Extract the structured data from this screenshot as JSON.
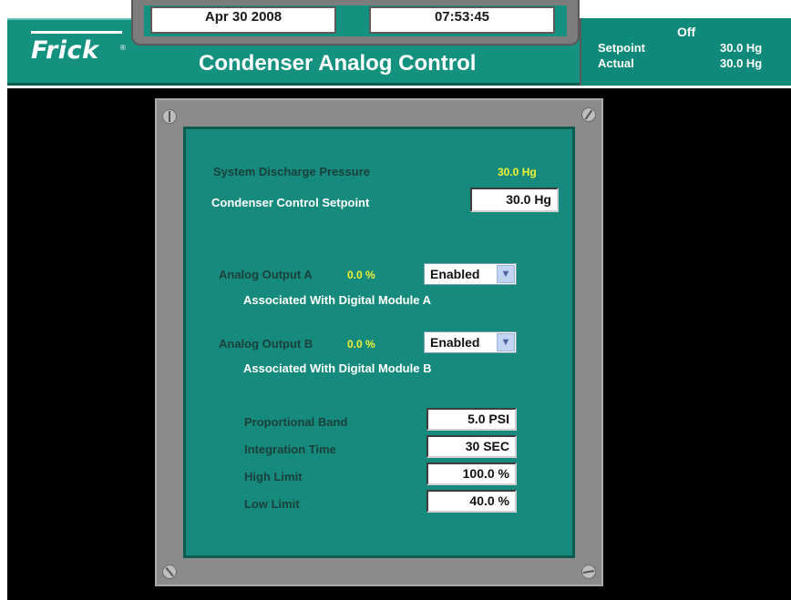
{
  "header": {
    "date": "Apr 30 2008",
    "time": "07:53:45",
    "logo": "Frick",
    "logo_mark": "®",
    "title": "Condenser Analog Control"
  },
  "status": {
    "state": "Off",
    "setpoint_label": "Setpoint",
    "setpoint_value": "30.0 Hg",
    "actual_label": "Actual",
    "actual_value": "30.0 Hg"
  },
  "panel": {
    "discharge_label": "System Discharge Pressure",
    "discharge_value": "30.0 Hg",
    "setpoint_label": "Condenser Control Setpoint",
    "setpoint_value": "30.0 Hg",
    "output_a": {
      "label": "Analog Output A",
      "value": "0.0 %",
      "mode": "Enabled",
      "note": "Associated With Digital Module A"
    },
    "output_b": {
      "label": "Analog Output B",
      "value": "0.0 %",
      "mode": "Enabled",
      "note": "Associated With Digital Module B"
    },
    "tuning": [
      {
        "label": "Proportional Band",
        "value": "5.0 PSI"
      },
      {
        "label": "Integration Time",
        "value": "30 SEC"
      },
      {
        "label": "High Limit",
        "value": "100.0 %"
      },
      {
        "label": "Low Limit",
        "value": "40.0 %"
      }
    ]
  },
  "icons": {
    "dropdown": "chevron-down-icon",
    "screw": "screw-icon"
  },
  "colors": {
    "panel_teal": "#168b7d",
    "value_yellow": "#f2f233",
    "background": "#000000"
  }
}
